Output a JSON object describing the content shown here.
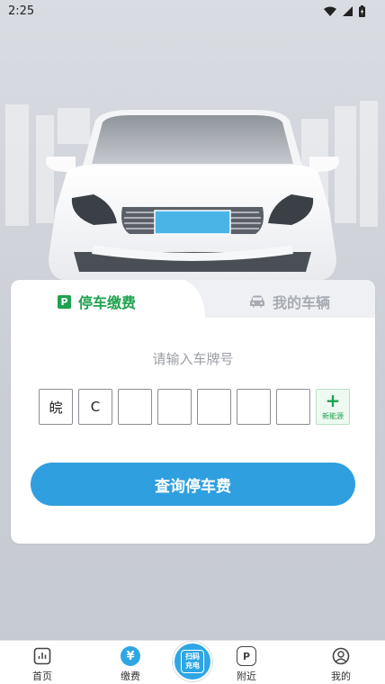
{
  "status_bar": {
    "time": "2:25"
  },
  "tabs": {
    "active_label": "停车缴费",
    "active_icon_letter": "P",
    "inactive_label": "我的车辆"
  },
  "form": {
    "hint": "请输入车牌号",
    "plate_chars": [
      "皖",
      "C",
      "",
      "",
      "",
      "",
      ""
    ],
    "new_energy_plus": "+",
    "new_energy_label": "新能源",
    "query_button": "查询停车费"
  },
  "bottom_nav": {
    "home": "首页",
    "pay": "缴费",
    "pay_icon_text": "¥",
    "scan_line1": "扫码",
    "scan_line2": "充电",
    "nearby": "附近",
    "nearby_icon_text": "P",
    "mine": "我的"
  },
  "colors": {
    "accent_green": "#1fa24e",
    "accent_blue": "#2f9fe0"
  },
  "icons": [
    "wifi-icon",
    "signal-icon",
    "battery-icon",
    "parking-icon",
    "car-icon",
    "home-icon",
    "yen-icon",
    "scan-charge-icon",
    "parking-nearby-icon",
    "user-icon"
  ]
}
